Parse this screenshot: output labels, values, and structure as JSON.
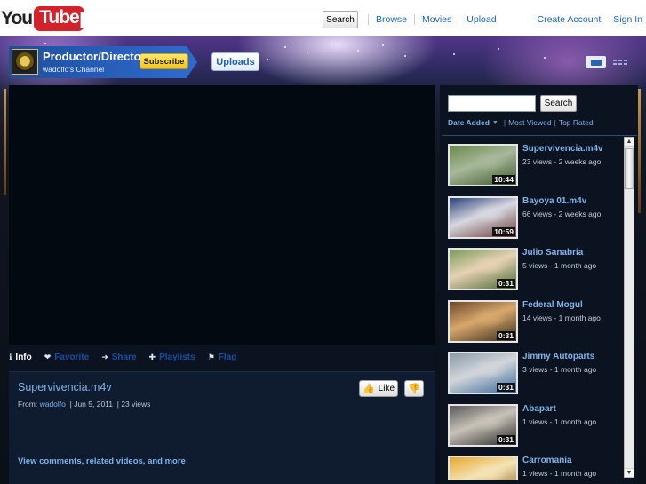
{
  "masthead": {
    "logo_you": "You",
    "logo_tube": "Tube",
    "search_button": "Search",
    "nav": [
      "Browse",
      "Movies",
      "Upload"
    ],
    "create_account": "Create Account",
    "sign_in": "Sign In"
  },
  "channel": {
    "title": "Productor/Director",
    "subtitle": "wadolfo's Channel",
    "subscribe": "Subscribe",
    "uploads": "Uploads",
    "icons": [
      "player-view-icon",
      "grid-view-icon"
    ]
  },
  "player": {
    "tabs": [
      {
        "icon": "info-icon",
        "glyph": "ℹ",
        "label": "Info",
        "active": true
      },
      {
        "icon": "heart-icon",
        "glyph": "❤",
        "label": "Favorite",
        "active": false
      },
      {
        "icon": "share-icon",
        "glyph": "➜",
        "label": "Share",
        "active": false
      },
      {
        "icon": "plus-icon",
        "glyph": "✚",
        "label": "Playlists",
        "active": false
      },
      {
        "icon": "flag-icon",
        "glyph": "⚑",
        "label": "Flag",
        "active": false
      }
    ],
    "video_title": "Supervivencia.m4v",
    "from_label": "From:",
    "author": "wadolfo",
    "date": "Jun 5, 2011",
    "views": "23 views",
    "like": "Like",
    "more_link": "View comments, related videos, and more"
  },
  "sidebar": {
    "search_button": "Search",
    "sort": {
      "selected": "Date Added",
      "options": [
        "Most Viewed",
        "Top Rated"
      ]
    },
    "videos": [
      {
        "title": "Supervivencia.m4v",
        "meta": "23 views - 2 weeks ago",
        "duration": "10:44",
        "palette": [
          "#6b8a4a",
          "#a7b89a",
          "#3e5a2c"
        ]
      },
      {
        "title": "Bayoya 01.m4v",
        "meta": "66 views - 2 weeks ago",
        "duration": "10:59",
        "palette": [
          "#2b3f78",
          "#d8d8e0",
          "#6a3d3a"
        ]
      },
      {
        "title": "Julio Sanabria",
        "meta": "5 views - 1 month ago",
        "duration": "0:31",
        "palette": [
          "#7a9a5a",
          "#e6d2b4",
          "#4d6a34"
        ]
      },
      {
        "title": "Federal Mogul",
        "meta": "14 views - 1 month ago",
        "duration": "0:31",
        "palette": [
          "#6a4a2c",
          "#d8a86c",
          "#3a2a1a"
        ]
      },
      {
        "title": "Jimmy Autoparts",
        "meta": "3 views - 1 month ago",
        "duration": "0:31",
        "palette": [
          "#8a9aa8",
          "#d2d6da",
          "#3a6a9a"
        ]
      },
      {
        "title": "Abapart",
        "meta": "1 views - 1 month ago",
        "duration": "0:31",
        "palette": [
          "#5a5a5a",
          "#c8c2b8",
          "#2a2a2a"
        ]
      },
      {
        "title": "Carromania",
        "meta": "1 views - 1 month ago",
        "duration": "",
        "palette": [
          "#e8a832",
          "#f4e4b4",
          "#8a5a1a"
        ]
      }
    ]
  }
}
